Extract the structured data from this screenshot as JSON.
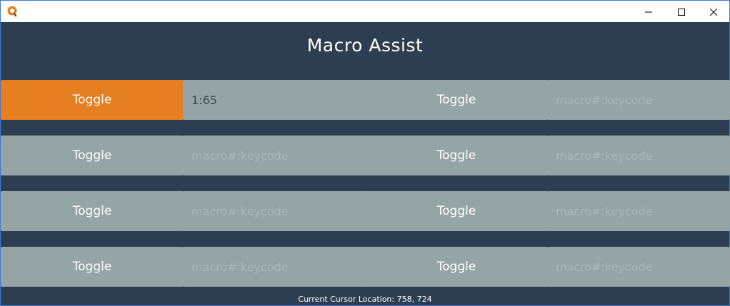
{
  "app": {
    "title": "Macro Assist"
  },
  "rows": [
    {
      "left": {
        "toggle_label": "Toggle",
        "active": true,
        "input_value": "1:65",
        "input_placeholder": ""
      },
      "right": {
        "toggle_label": "Toggle",
        "active": false,
        "input_value": "",
        "input_placeholder": "macro#:keycode"
      }
    },
    {
      "left": {
        "toggle_label": "Toggle",
        "active": false,
        "input_value": "",
        "input_placeholder": "macro#:keycode"
      },
      "right": {
        "toggle_label": "Toggle",
        "active": false,
        "input_value": "",
        "input_placeholder": "macro#:keycode"
      }
    },
    {
      "left": {
        "toggle_label": "Toggle",
        "active": false,
        "input_value": "",
        "input_placeholder": "macro#:keycode"
      },
      "right": {
        "toggle_label": "Toggle",
        "active": false,
        "input_value": "",
        "input_placeholder": "macro#:keycode"
      }
    },
    {
      "left": {
        "toggle_label": "Toggle",
        "active": false,
        "input_value": "",
        "input_placeholder": "macro#:keycode"
      },
      "right": {
        "toggle_label": "Toggle",
        "active": false,
        "input_value": "",
        "input_placeholder": "macro#:keycode"
      }
    }
  ],
  "status": {
    "cursor_location": "Current Cursor Location: 758, 724"
  },
  "colors": {
    "background": "#2c3e50",
    "cell": "#95a5a6",
    "active_toggle": "#e67e22"
  },
  "icons": {
    "app": "app-logo-icon",
    "minimize": "minimize-icon",
    "maximize": "maximize-icon",
    "close": "close-icon"
  }
}
